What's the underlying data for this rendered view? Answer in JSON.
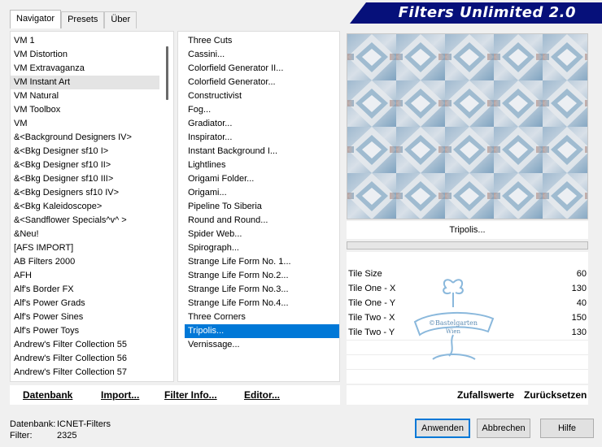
{
  "banner": {
    "title": "Filters Unlimited 2.0"
  },
  "tabs": [
    {
      "label": "Navigator"
    },
    {
      "label": "Presets"
    },
    {
      "label": "Über"
    }
  ],
  "categories": [
    "VM 1",
    "VM Distortion",
    "VM Extravaganza",
    "VM Instant Art",
    "VM Natural",
    "VM Toolbox",
    "VM",
    "&<Background Designers IV>",
    "&<Bkg Designer sf10 I>",
    "&<Bkg Designer sf10 II>",
    "&<Bkg Designer sf10 III>",
    "&<Bkg Designers sf10 IV>",
    "&<Bkg Kaleidoscope>",
    "&<Sandflower Specials^v^ >",
    "&Neu!",
    "[AFS IMPORT]",
    "AB Filters 2000",
    "AFH",
    "Alf's Border FX",
    "Alf's Power Grads",
    "Alf's Power Sines",
    "Alf's Power Toys",
    "Andrew's Filter Collection 55",
    "Andrew's Filter Collection 56",
    "Andrew's Filter Collection 57",
    "Andrew's Filter Collection 58"
  ],
  "selected_category": "VM Instant Art",
  "filters": [
    "Three Cuts",
    "Cassini...",
    "Colorfield Generator II...",
    "Colorfield Generator...",
    "Constructivist",
    "Fog...",
    "Gradiator...",
    "Inspirator...",
    "Instant Background I...",
    "Lightlines",
    "Origami Folder...",
    "Origami...",
    "Pipeline To Siberia",
    "Round and Round...",
    "Spider Web...",
    "Spirograph...",
    "Strange Life Form No. 1...",
    "Strange Life Form No.2...",
    "Strange Life Form No.3...",
    "Strange Life Form No.4...",
    "Three Corners",
    "Tripolis...",
    "Vernissage..."
  ],
  "selected_filter": "Tripolis...",
  "preview": {
    "filter_name": "Tripolis..."
  },
  "params": [
    {
      "label": "Tile Size",
      "value": "60"
    },
    {
      "label": "Tile One - X",
      "value": "130"
    },
    {
      "label": "Tile One - Y",
      "value": "40"
    },
    {
      "label": "Tile Two - X",
      "value": "150"
    },
    {
      "label": "Tile Two - Y",
      "value": "130"
    }
  ],
  "actions": {
    "database": "Datenbank",
    "import": "Import...",
    "filter_info": "Filter Info...",
    "editor": "Editor...",
    "randomize": "Zufallswerte",
    "reset": "Zurücksetzen"
  },
  "status": {
    "database_label": "Datenbank:",
    "database_value": "ICNET-Filters",
    "filter_label": "Filter:",
    "filter_value": "2325"
  },
  "buttons": {
    "apply": "Anwenden",
    "cancel": "Abbrechen",
    "help": "Hilfe"
  },
  "watermark": {
    "line1": "©Bastelgarten",
    "line2": "Wien"
  },
  "colors": {
    "banner": "#06107a",
    "selection": "#0078d7",
    "watermark": "#8ab8dc"
  }
}
